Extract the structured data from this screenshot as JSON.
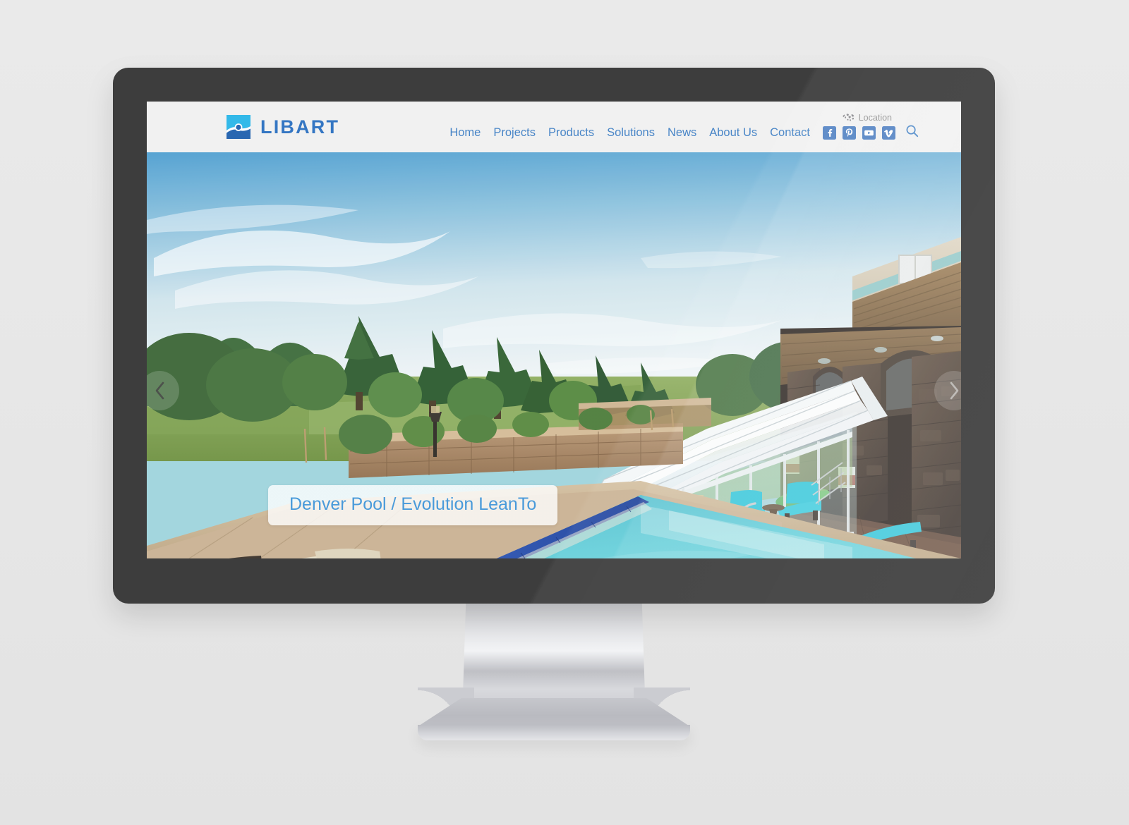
{
  "device": {
    "type": "desktop-monitor",
    "bezel_color": "#333333",
    "stand_color": "#cbccd1",
    "backdrop_color": "#e8e8e8"
  },
  "site": {
    "brand": {
      "name": "LIBART",
      "logo_icon": "libart-pool-logo-icon",
      "logo_colors": {
        "top": "#29b6e8",
        "bottom": "#1e5fad",
        "accent": "#2a6fc0"
      },
      "text_color": "#2a6fc0"
    },
    "header": {
      "background": "#f1f1f1",
      "location": {
        "icon": "world-map-icon",
        "label": "Location",
        "color": "#8a8a8a"
      },
      "nav_links": [
        {
          "label": "Home"
        },
        {
          "label": "Projects"
        },
        {
          "label": "Products"
        },
        {
          "label": "Solutions"
        },
        {
          "label": "News"
        },
        {
          "label": "About Us"
        },
        {
          "label": "Contact"
        }
      ],
      "nav_link_color": "#3f7fc4",
      "social_links": [
        {
          "icon": "facebook-icon",
          "label": "Facebook"
        },
        {
          "icon": "pinterest-icon",
          "label": "Pinterest"
        },
        {
          "icon": "youtube-icon",
          "label": "YouTube"
        },
        {
          "icon": "vimeo-icon",
          "label": "Vimeo"
        }
      ],
      "search": {
        "icon": "search-icon",
        "label": "Search"
      }
    },
    "hero": {
      "caption": "Denver Pool / Evolution LeanTo",
      "caption_text_color": "#3f95d8",
      "prev_arrow": {
        "icon": "chevron-left-icon",
        "label": "Previous slide"
      },
      "next_arrow": {
        "icon": "chevron-right-icon",
        "label": "Next slide"
      },
      "scene": {
        "description": "Outdoor swimming pool with retractable glass LeanTo enclosure",
        "sky_top": "#5aa8d8",
        "sky_bottom": "#e8f2f6",
        "pool_water": "#53c6d4",
        "deck_stone": "#cdb796",
        "lounge_chair_color": "#2ec4d8",
        "float_color": "#35a836"
      }
    }
  }
}
